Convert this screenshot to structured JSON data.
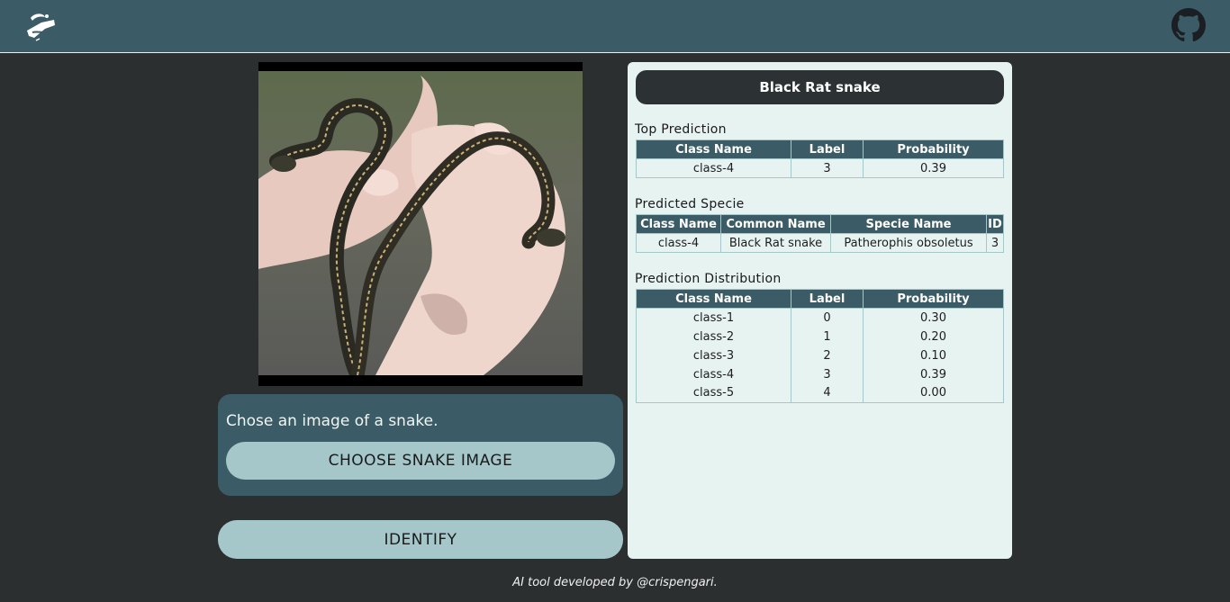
{
  "header": {
    "logo_icon": "snake-hand-logo-icon",
    "github_icon": "github-icon"
  },
  "upload": {
    "prompt": "Chose an image of a snake.",
    "choose_label": "CHOOSE SNAKE IMAGE",
    "identify_label": "IDENTIFY"
  },
  "result": {
    "title": "Black Rat snake",
    "top_prediction": {
      "label": "Top Prediction",
      "headers": [
        "Class Name",
        "Label",
        "Probability"
      ],
      "rows": [
        [
          "class-4",
          "3",
          "0.39"
        ]
      ]
    },
    "predicted_specie": {
      "label": "Predicted Specie",
      "headers": [
        "Class Name",
        "Common Name",
        "Specie Name",
        "ID"
      ],
      "rows": [
        [
          "class-4",
          "Black Rat snake",
          "Patherophis obsoletus",
          "3"
        ]
      ]
    },
    "distribution": {
      "label": "Prediction Distribution",
      "headers": [
        "Class Name",
        "Label",
        "Probability"
      ],
      "rows": [
        [
          "class-1",
          "0",
          "0.30"
        ],
        [
          "class-2",
          "1",
          "0.20"
        ],
        [
          "class-3",
          "2",
          "0.10"
        ],
        [
          "class-4",
          "3",
          "0.39"
        ],
        [
          "class-5",
          "4",
          "0.00"
        ]
      ]
    }
  },
  "footer": {
    "credit": "AI tool developed by @crispengari."
  },
  "colors": {
    "header": "#3b5c66",
    "background": "#2c2f30",
    "panel": "#e6f3f1",
    "button": "#a5c7ca"
  }
}
